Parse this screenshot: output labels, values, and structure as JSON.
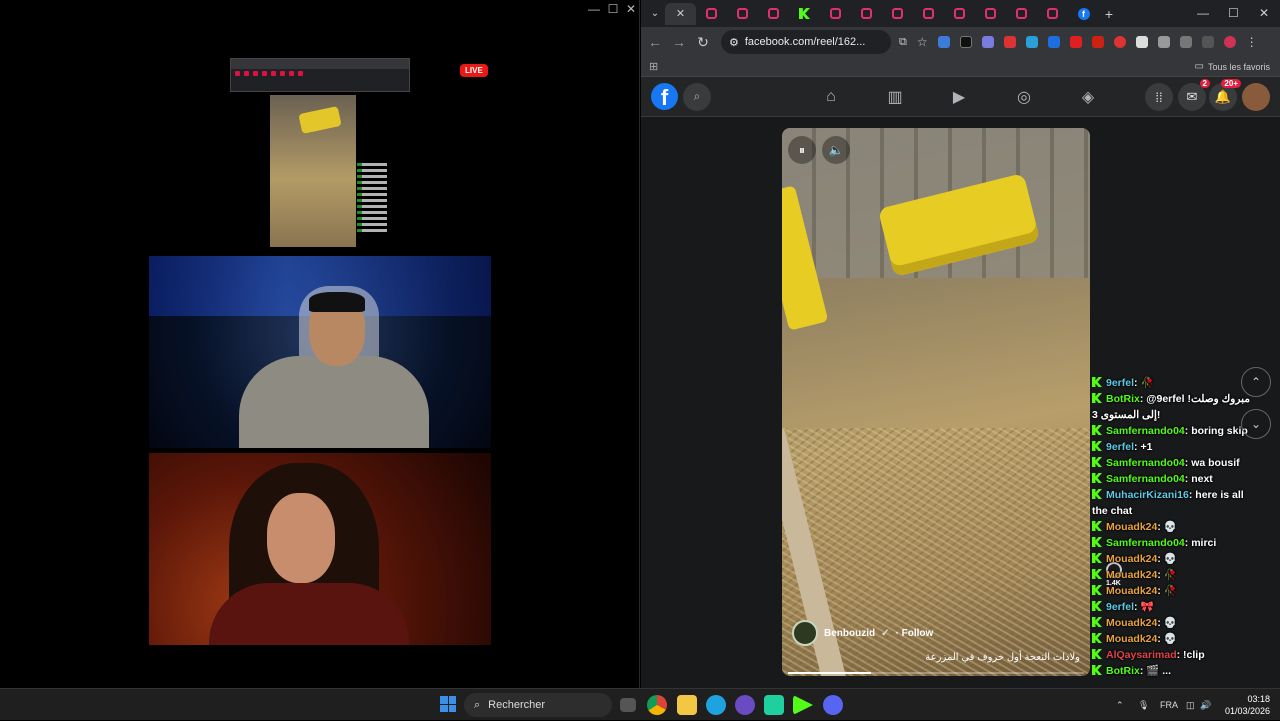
{
  "left_window": {
    "controls": [
      "—",
      "☐",
      "✕"
    ],
    "live_badge": "LIVE"
  },
  "browser": {
    "tab_count": 14,
    "new_tab": "+",
    "window_controls": [
      "—",
      "☐",
      "✕"
    ],
    "url": "facebook.com/reel/162...",
    "bookmarks_label": "Tous les favoris"
  },
  "facebook": {
    "logo": "f",
    "messenger_badge": "2",
    "notifications_badge": "20+"
  },
  "reel": {
    "author": "Benbouzid",
    "follow_label": "· Follow",
    "caption": "ولادات النعجة أول خروف في المزرعة",
    "progress": 0.28,
    "likes": "1.4K"
  },
  "chat": [
    {
      "user": "9erfel",
      "color": "#5ec8e5",
      "msg": "🥀"
    },
    {
      "user": "BotRix",
      "color": "#53fc18",
      "msg": "@9erfel !مبروك وصلت إلى المستوى 3!"
    },
    {
      "user": "Samfernando04",
      "color": "#53fc18",
      "msg": "boring skip"
    },
    {
      "user": "9erfel",
      "color": "#5ec8e5",
      "msg": "+1"
    },
    {
      "user": "Samfernando04",
      "color": "#53fc18",
      "msg": "wa bousif"
    },
    {
      "user": "Samfernando04",
      "color": "#53fc18",
      "msg": "next"
    },
    {
      "user": "MuhacirKizani16",
      "color": "#5ec8e5",
      "msg": "here is all the chat"
    },
    {
      "user": "Mouadk24",
      "color": "#e8a33c",
      "msg": "💀"
    },
    {
      "user": "Samfernando04",
      "color": "#53fc18",
      "msg": "mirci"
    },
    {
      "user": "Mouadk24",
      "color": "#e8a33c",
      "msg": "💀"
    },
    {
      "user": "Mouadk24",
      "color": "#e8a33c",
      "msg": "🥀"
    },
    {
      "user": "Mouadk24",
      "color": "#e8a33c",
      "msg": "🥀"
    },
    {
      "user": "9erfel",
      "color": "#5ec8e5",
      "msg": "🎀"
    },
    {
      "user": "Mouadk24",
      "color": "#e8a33c",
      "msg": "💀"
    },
    {
      "user": "Mouadk24",
      "color": "#e8a33c",
      "msg": "💀"
    },
    {
      "user": "AlQaysarimad",
      "color": "#e0434a",
      "msg": "!clip"
    },
    {
      "user": "BotRix",
      "color": "#53fc18",
      "msg": "🎬 ..."
    }
  ],
  "taskbar": {
    "search_placeholder": "Rechercher",
    "language": "FRA",
    "time": "03:18",
    "date": "01/03/2026"
  }
}
